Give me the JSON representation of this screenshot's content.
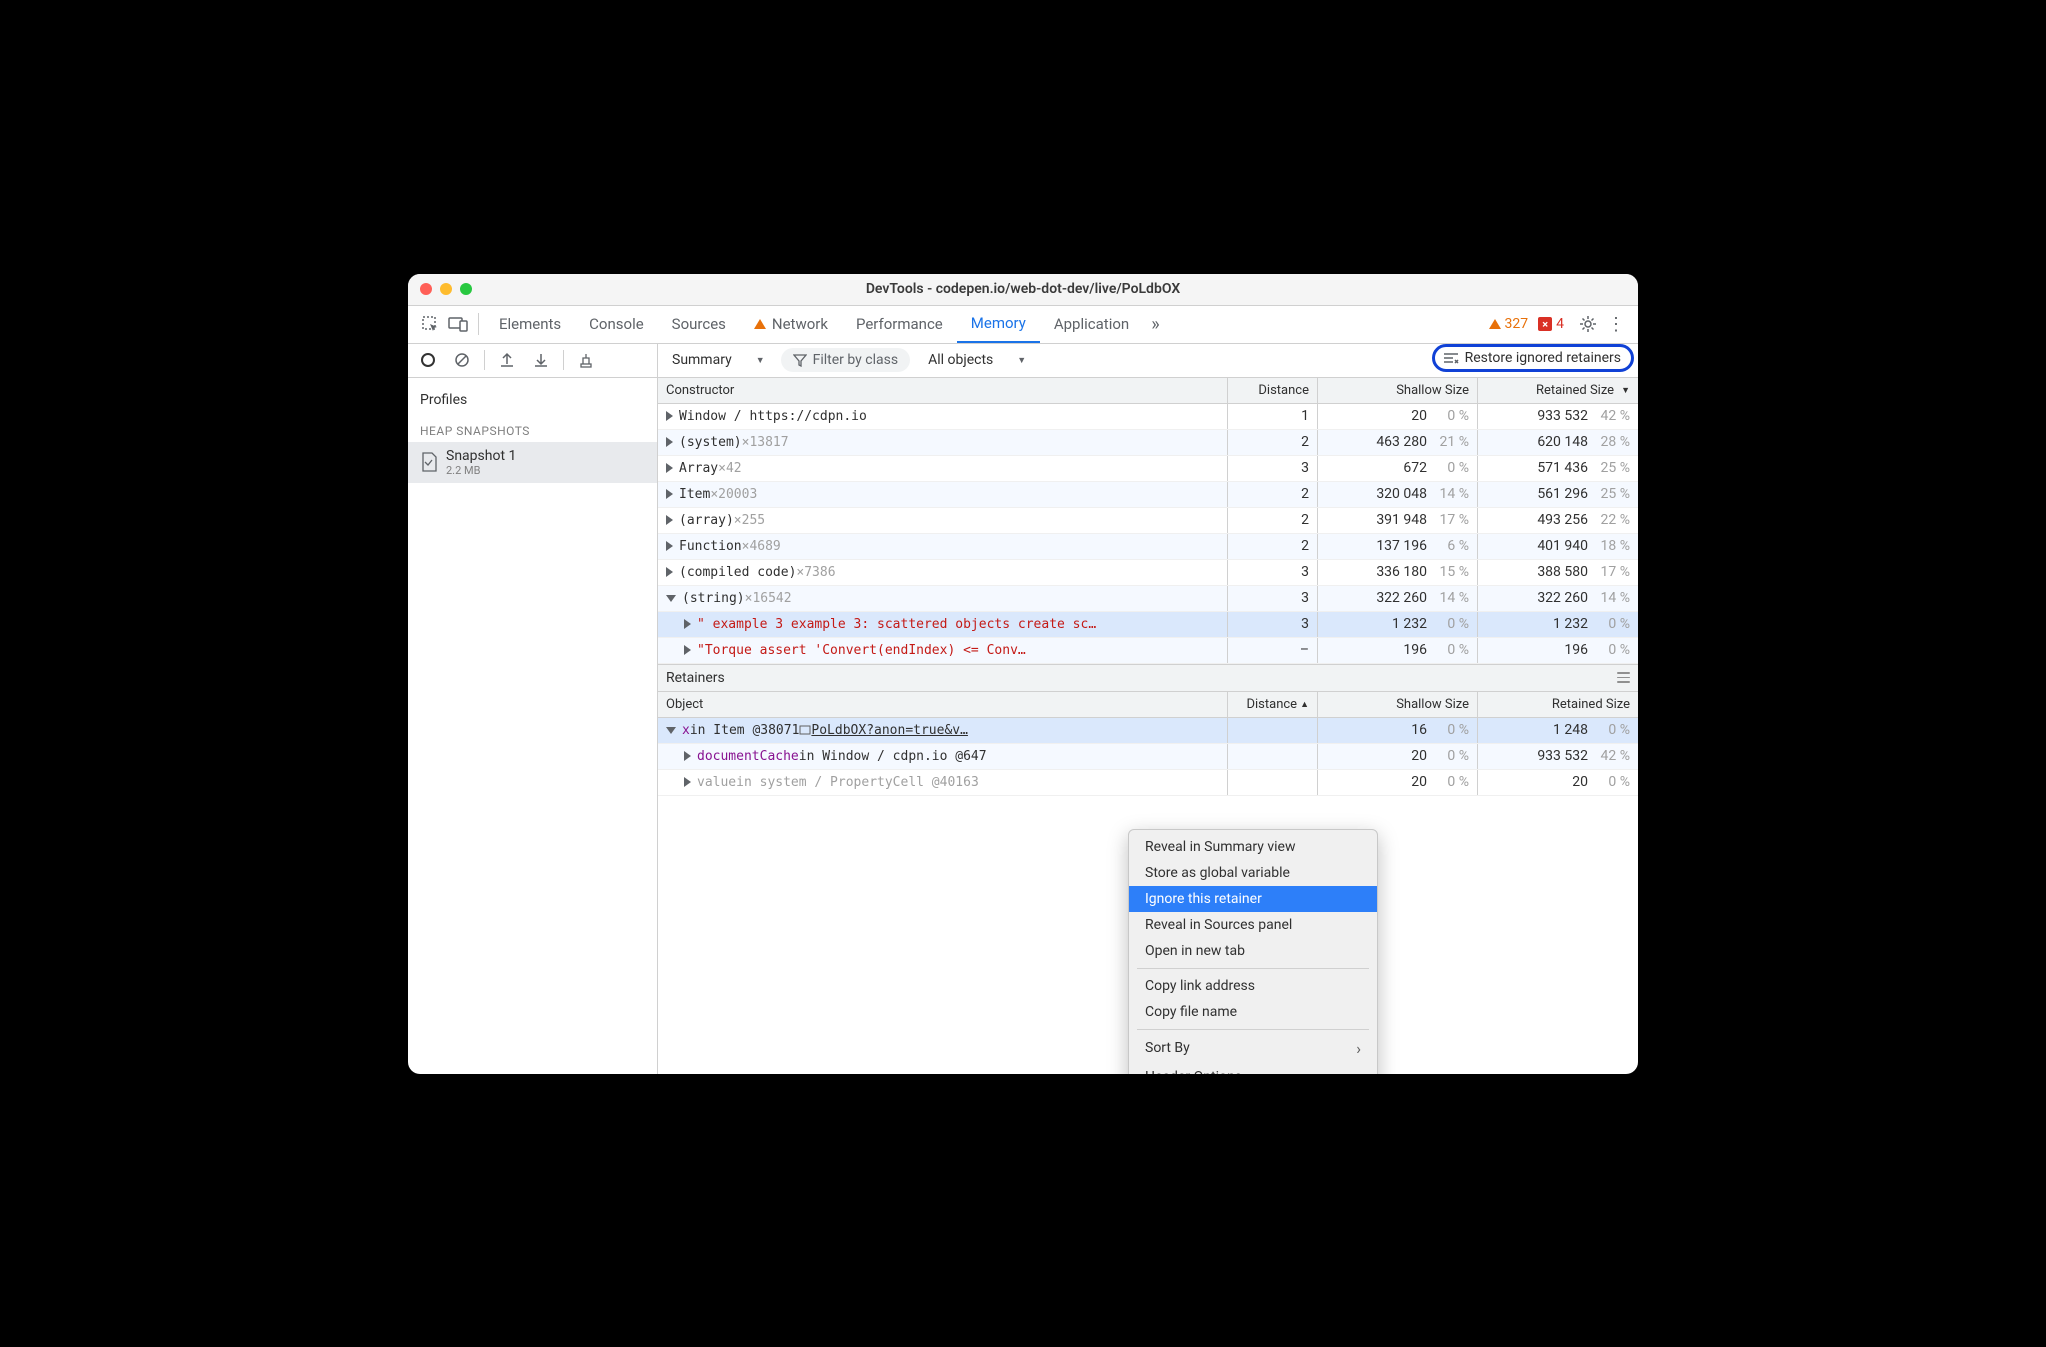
{
  "window": {
    "title": "DevTools - codepen.io/web-dot-dev/live/PoLdbOX"
  },
  "tabs": [
    "Elements",
    "Console",
    "Sources",
    "Network",
    "Performance",
    "Memory",
    "Application"
  ],
  "tabs_active_index": 5,
  "tabs_warn_index": 3,
  "counts": {
    "warn": "327",
    "err": "4"
  },
  "toolbar": {
    "summary_label": "Summary",
    "filter_placeholder": "Filter by class",
    "scope_label": "All objects",
    "restore_label": "Restore ignored retainers"
  },
  "sidebar": {
    "profiles_label": "Profiles",
    "section_label": "HEAP SNAPSHOTS",
    "item": {
      "name": "Snapshot 1",
      "size": "2.2 MB"
    }
  },
  "grid": {
    "headers": {
      "constructor": "Constructor",
      "distance": "Distance",
      "shallow": "Shallow Size",
      "retained": "Retained Size"
    },
    "rows": [
      {
        "label": "Window / https://cdpn.io",
        "count": "",
        "dist": "1",
        "sh": "20",
        "shp": "0 %",
        "ret": "933 532",
        "retp": "42 %"
      },
      {
        "label": "(system)",
        "count": "×13817",
        "dist": "2",
        "sh": "463 280",
        "shp": "21 %",
        "ret": "620 148",
        "retp": "28 %"
      },
      {
        "label": "Array",
        "count": "×42",
        "dist": "3",
        "sh": "672",
        "shp": "0 %",
        "ret": "571 436",
        "retp": "25 %"
      },
      {
        "label": "Item",
        "count": "×20003",
        "dist": "2",
        "sh": "320 048",
        "shp": "14 %",
        "ret": "561 296",
        "retp": "25 %"
      },
      {
        "label": "(array)",
        "count": "×255",
        "dist": "2",
        "sh": "391 948",
        "shp": "17 %",
        "ret": "493 256",
        "retp": "22 %"
      },
      {
        "label": "Function",
        "count": "×4689",
        "dist": "2",
        "sh": "137 196",
        "shp": "6 %",
        "ret": "401 940",
        "retp": "18 %"
      },
      {
        "label": "(compiled code)",
        "count": "×7386",
        "dist": "3",
        "sh": "336 180",
        "shp": "15 %",
        "ret": "388 580",
        "retp": "17 %"
      },
      {
        "label": "(string)",
        "count": "×16542",
        "dist": "3",
        "sh": "322 260",
        "shp": "14 %",
        "ret": "322 260",
        "retp": "14 %",
        "open": true
      },
      {
        "label": "\" example 3 example 3: scattered objects create sc…",
        "indent": 1,
        "string": true,
        "dist": "3",
        "sh": "1 232",
        "shp": "0 %",
        "ret": "1 232",
        "retp": "0 %",
        "sel": true
      },
      {
        "label": "\"Torque assert 'Convert<uintptr>(endIndex) <= Conv…",
        "indent": 1,
        "string": true,
        "dist": "–",
        "sh": "196",
        "shp": "0 %",
        "ret": "196",
        "retp": "0 %"
      }
    ]
  },
  "retainers": {
    "title": "Retainers",
    "headers": {
      "object": "Object",
      "distance": "Distance",
      "shallow": "Shallow Size",
      "retained": "Retained Size"
    },
    "rows": [
      {
        "html_prop": "x",
        "html_mid": " in Item @38071 ",
        "html_link": "PoLdbOX?anon=true&v…",
        "dist": "",
        "sh": "16",
        "shp": "0 %",
        "ret": "1 248",
        "retp": "0 %",
        "open": true,
        "sel": true
      },
      {
        "html_prop": "documentCache",
        "html_mid": " in Window / cdpn.io @647",
        "dist": "",
        "sh": "20",
        "shp": "0 %",
        "ret": "933 532",
        "retp": "42 %",
        "indent": 1
      },
      {
        "html_prop": "value",
        "html_mid": " in system / PropertyCell @40163",
        "dist": "",
        "sh": "20",
        "shp": "0 %",
        "ret": "20",
        "retp": "0 %",
        "indent": 1,
        "dim": true
      }
    ]
  },
  "menu": {
    "items": [
      "Reveal in Summary view",
      "Store as global variable",
      "Ignore this retainer",
      "Reveal in Sources panel",
      "Open in new tab"
    ],
    "highlight_index": 2,
    "items2": [
      "Copy link address",
      "Copy file name"
    ],
    "items3": [
      "Sort By",
      "Header Options"
    ]
  }
}
